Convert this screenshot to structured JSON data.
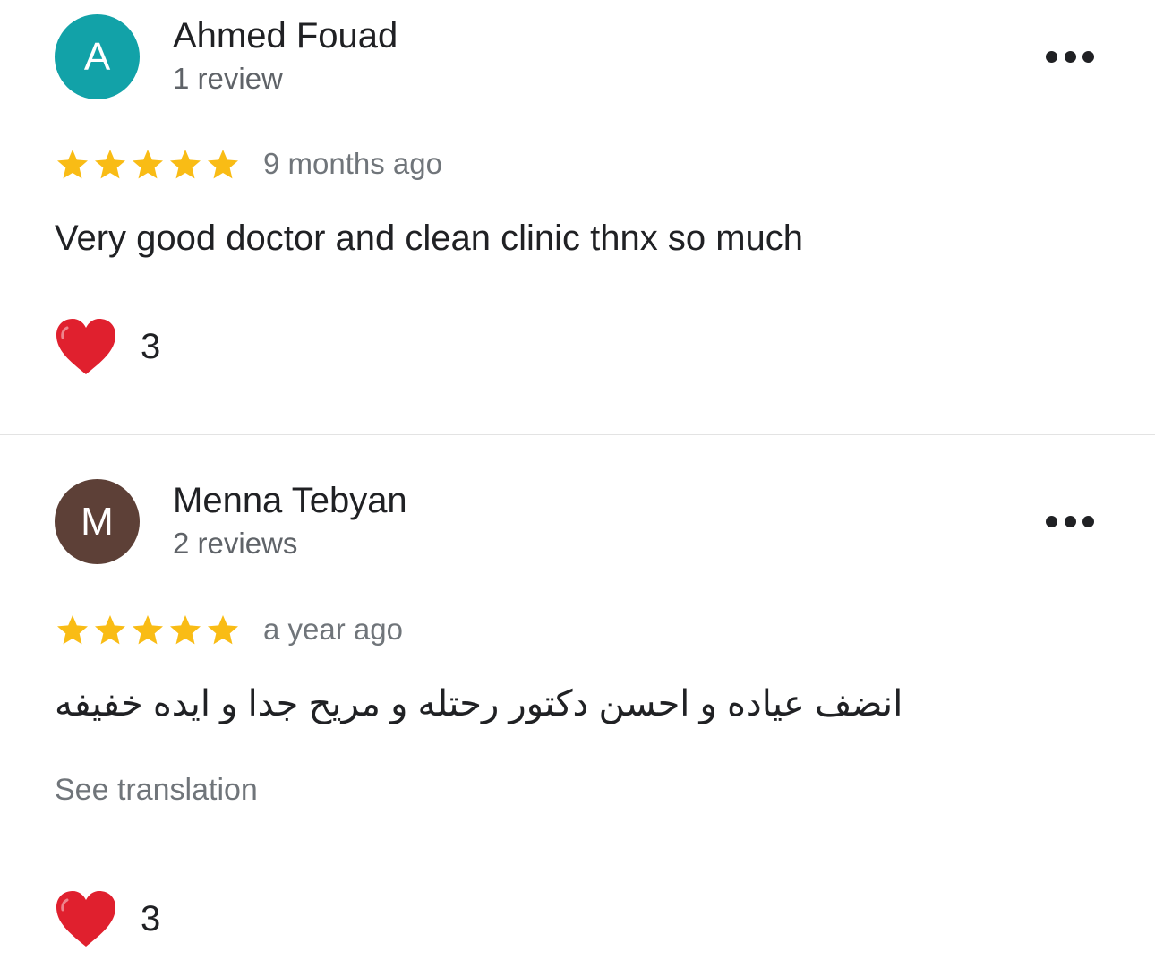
{
  "colors": {
    "star": "#F9BC15",
    "heart": "#E0202E",
    "text_primary": "#202124",
    "text_secondary": "#5F6368"
  },
  "reviews": [
    {
      "avatar_letter": "A",
      "avatar_color": "#12A2A8",
      "name": "Ahmed Fouad",
      "review_count": "1 review",
      "rating": 5,
      "time": "9 months ago",
      "text": "Very good doctor and clean clinic thnx so much",
      "reaction_icon": "red-heart-icon",
      "reaction_count": "3"
    },
    {
      "avatar_letter": "M",
      "avatar_color": "#5D4037",
      "name": "Menna Tebyan",
      "review_count": "2 reviews",
      "rating": 5,
      "time": "a year ago",
      "text": "انضف عياده و احسن دكتور رحتله و مريح جدا و ايده خفيفه",
      "translate_label": "See translation",
      "reaction_icon": "red-heart-icon",
      "reaction_count": "3"
    }
  ]
}
